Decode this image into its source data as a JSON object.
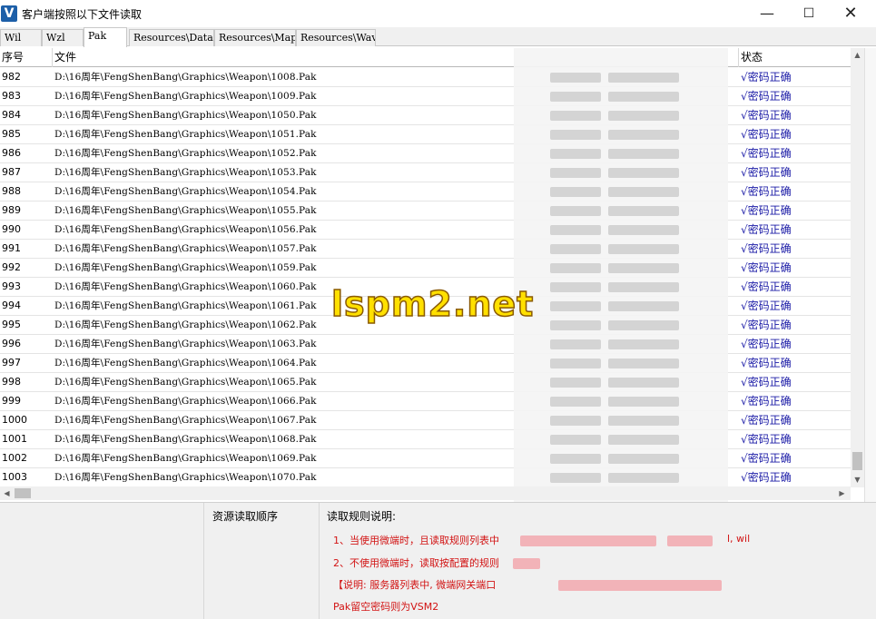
{
  "window": {
    "app_icon": "V",
    "title": "客户端按照以下文件读取",
    "minimize": "—",
    "maximize": "☐",
    "close": "✕"
  },
  "tabs": [
    {
      "label": "Wil"
    },
    {
      "label": "Wzl"
    },
    {
      "label": "Pak",
      "active": true
    },
    {
      "label": "Resources\\Data"
    },
    {
      "label": "Resources\\Map"
    },
    {
      "label": "Resources\\Wav"
    }
  ],
  "table": {
    "columns": {
      "seq": "序号",
      "file": "文件",
      "status": "状态"
    },
    "rows": [
      {
        "seq": "982",
        "file": "D:\\16周年\\FengShenBang\\Graphics\\Weapon\\1008.Pak",
        "status": "√密码正确"
      },
      {
        "seq": "983",
        "file": "D:\\16周年\\FengShenBang\\Graphics\\Weapon\\1009.Pak",
        "status": "√密码正确"
      },
      {
        "seq": "984",
        "file": "D:\\16周年\\FengShenBang\\Graphics\\Weapon\\1050.Pak",
        "status": "√密码正确"
      },
      {
        "seq": "985",
        "file": "D:\\16周年\\FengShenBang\\Graphics\\Weapon\\1051.Pak",
        "status": "√密码正确"
      },
      {
        "seq": "986",
        "file": "D:\\16周年\\FengShenBang\\Graphics\\Weapon\\1052.Pak",
        "status": "√密码正确"
      },
      {
        "seq": "987",
        "file": "D:\\16周年\\FengShenBang\\Graphics\\Weapon\\1053.Pak",
        "status": "√密码正确"
      },
      {
        "seq": "988",
        "file": "D:\\16周年\\FengShenBang\\Graphics\\Weapon\\1054.Pak",
        "status": "√密码正确"
      },
      {
        "seq": "989",
        "file": "D:\\16周年\\FengShenBang\\Graphics\\Weapon\\1055.Pak",
        "status": "√密码正确"
      },
      {
        "seq": "990",
        "file": "D:\\16周年\\FengShenBang\\Graphics\\Weapon\\1056.Pak",
        "status": "√密码正确"
      },
      {
        "seq": "991",
        "file": "D:\\16周年\\FengShenBang\\Graphics\\Weapon\\1057.Pak",
        "status": "√密码正确"
      },
      {
        "seq": "992",
        "file": "D:\\16周年\\FengShenBang\\Graphics\\Weapon\\1059.Pak",
        "status": "√密码正确"
      },
      {
        "seq": "993",
        "file": "D:\\16周年\\FengShenBang\\Graphics\\Weapon\\1060.Pak",
        "status": "√密码正确"
      },
      {
        "seq": "994",
        "file": "D:\\16周年\\FengShenBang\\Graphics\\Weapon\\1061.Pak",
        "status": "√密码正确"
      },
      {
        "seq": "995",
        "file": "D:\\16周年\\FengShenBang\\Graphics\\Weapon\\1062.Pak",
        "status": "√密码正确"
      },
      {
        "seq": "996",
        "file": "D:\\16周年\\FengShenBang\\Graphics\\Weapon\\1063.Pak",
        "status": "√密码正确"
      },
      {
        "seq": "997",
        "file": "D:\\16周年\\FengShenBang\\Graphics\\Weapon\\1064.Pak",
        "status": "√密码正确"
      },
      {
        "seq": "998",
        "file": "D:\\16周年\\FengShenBang\\Graphics\\Weapon\\1065.Pak",
        "status": "√密码正确"
      },
      {
        "seq": "999",
        "file": "D:\\16周年\\FengShenBang\\Graphics\\Weapon\\1066.Pak",
        "status": "√密码正确"
      },
      {
        "seq": "1000",
        "file": "D:\\16周年\\FengShenBang\\Graphics\\Weapon\\1067.Pak",
        "status": "√密码正确"
      },
      {
        "seq": "1001",
        "file": "D:\\16周年\\FengShenBang\\Graphics\\Weapon\\1068.Pak",
        "status": "√密码正确"
      },
      {
        "seq": "1002",
        "file": "D:\\16周年\\FengShenBang\\Graphics\\Weapon\\1069.Pak",
        "status": "√密码正确"
      },
      {
        "seq": "1003",
        "file": "D:\\16周年\\FengShenBang\\Graphics\\Weapon\\1070.Pak",
        "status": "√密码正确"
      }
    ]
  },
  "scrollbars": {
    "up": "▲",
    "down": "▼",
    "left": "◀",
    "right": "▶"
  },
  "bottom": {
    "resource_order_label": "资源读取顺序",
    "rules_label": "读取规则说明:",
    "rule1_prefix": "1、当使用微端时，且读取规则列表中",
    "rule1_suffix": "l, wil",
    "rule2": "2、不使用微端时，读取按配置的规则",
    "rule3": "【说明: 服务器列表中, 微端网关端口",
    "rule4": "Pak留空密码则为VSM2"
  },
  "watermark": "lspm2.net"
}
